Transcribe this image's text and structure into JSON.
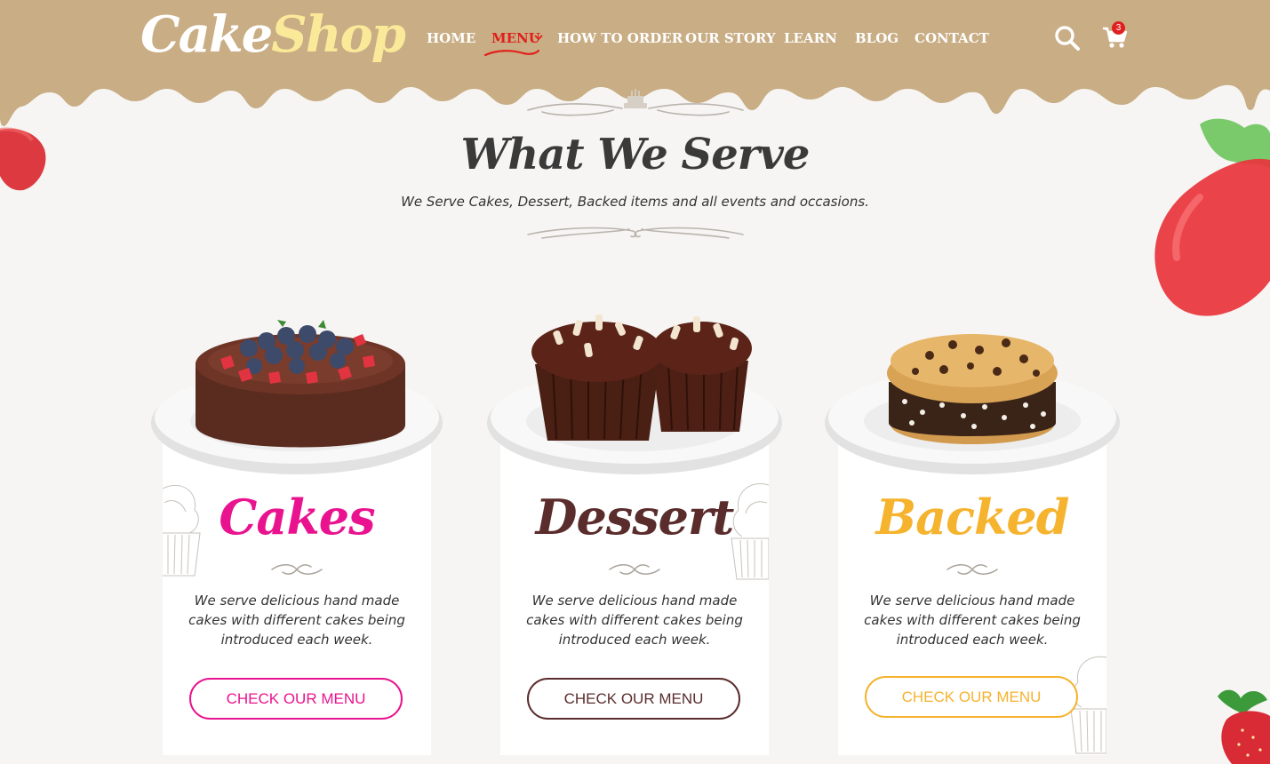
{
  "brand": {
    "logo_part1": "Cake",
    "logo_part2": "Shop"
  },
  "nav": {
    "items": [
      {
        "label": "HOME"
      },
      {
        "label": "MENU"
      },
      {
        "label": "HOW TO ORDER"
      },
      {
        "label": "OUR STORY"
      },
      {
        "label": "LEARN"
      },
      {
        "label": "BLOG"
      },
      {
        "label": "CONTACT"
      }
    ],
    "active": "MENU"
  },
  "cart": {
    "count": "3"
  },
  "section": {
    "title": "What We Serve",
    "subtitle": "We Serve Cakes, Dessert, Backed items and all events and occasions."
  },
  "cards": [
    {
      "title": "Cakes",
      "description": "We serve delicious hand made cakes with different cakes being introduced each week.",
      "button": "CHECK OUR MENU",
      "accent": "#e9138f"
    },
    {
      "title": "Dessert",
      "description": "We serve delicious hand made cakes with different cakes being introduced each week.",
      "button": "CHECK OUR MENU",
      "accent": "#5b2c2c"
    },
    {
      "title": "Backed",
      "description": "We serve delicious hand made cakes with different cakes being introduced each week.",
      "button": "CHECK OUR MENU",
      "accent": "#f5b32e"
    }
  ],
  "colors": {
    "header": "#c9ad84",
    "background": "#f6f5f3",
    "nav_active": "#e0201b"
  },
  "icons": [
    "search-icon",
    "cart-icon",
    "chevron-down-icon"
  ]
}
